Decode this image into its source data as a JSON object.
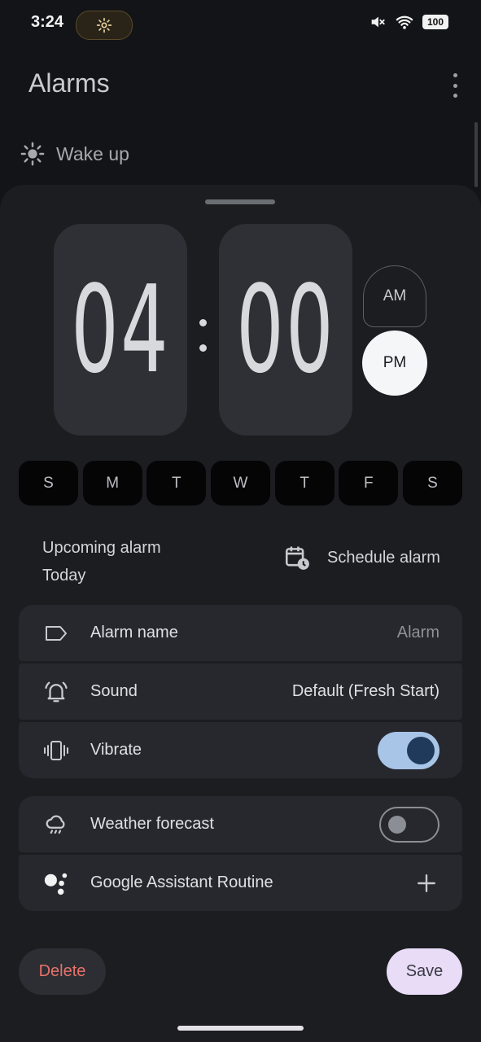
{
  "status_bar": {
    "time": "3:24",
    "battery": "100"
  },
  "header": {
    "title": "Alarms"
  },
  "background_alarm": {
    "label": "Wake up"
  },
  "time_picker": {
    "hour": "04",
    "minute": "00",
    "am_label": "AM",
    "pm_label": "PM",
    "selected_period": "PM"
  },
  "days": [
    {
      "label": "S"
    },
    {
      "label": "M"
    },
    {
      "label": "T"
    },
    {
      "label": "W"
    },
    {
      "label": "T"
    },
    {
      "label": "F"
    },
    {
      "label": "S"
    }
  ],
  "upcoming": {
    "title": "Upcoming alarm",
    "when": "Today"
  },
  "schedule": {
    "label": "Schedule alarm"
  },
  "settings": {
    "alarm_name": {
      "label": "Alarm name",
      "value": "Alarm"
    },
    "sound": {
      "label": "Sound",
      "value": "Default (Fresh Start)"
    },
    "vibrate": {
      "label": "Vibrate",
      "enabled": true
    },
    "weather": {
      "label": "Weather forecast",
      "enabled": false
    },
    "assistant": {
      "label": "Google Assistant Routine"
    }
  },
  "actions": {
    "delete_label": "Delete",
    "save_label": "Save"
  },
  "colors": {
    "accent_toggle": "#a8c4e6",
    "delete_text": "#e8716b",
    "save_bg": "#e8dcf7"
  }
}
